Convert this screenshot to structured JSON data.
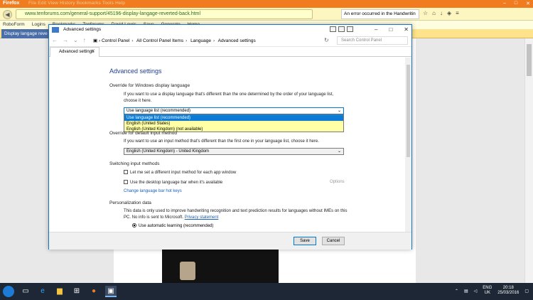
{
  "firefox": {
    "brand": "Firefox",
    "menus": "File  Edit  View  History  Bookmarks  Tools  Help",
    "url": "www.tenforums.com/general-support/45196-display-langage-reverted-back.html",
    "notice": "An error occurred in the Handwritin",
    "bookmarks": [
      "RoboForm",
      "Logins",
      "Bookmarks",
      "Tenforums",
      "David Lewis",
      "Save",
      "Generate",
      "Home"
    ],
    "tab_title": "Display langage reve"
  },
  "dialog": {
    "title": "Advanced settings",
    "breadcrumb": [
      "Control Panel",
      "All Control Panel Items",
      "Language",
      "Advanced settings"
    ],
    "search_placeholder": "Search Control Panel",
    "tab_label": "Advanced settings",
    "heading": "Advanced settings",
    "section1": "Override for Windows display language",
    "section1_text": "If you want to use a display language that's different than the one determined by the order of your language list, choose it here.",
    "combo1_value": "Use language list (recommended)",
    "dropdown_options": [
      "Use language list (recommended)",
      "English (United States)",
      "English (United Kingdom) (not available)"
    ],
    "section2": "Override for default input method",
    "section2_text": "If you want to use an input method that's different than the first one in your language list, choose it here.",
    "combo2_value": "English (United Kingdom) - United Kingdom",
    "section3": "Switching input methods",
    "check1": "Let me set a different input method for each app window",
    "check2": "Use the desktop language bar when it's available",
    "options_label": "Options",
    "hotkeys_link": "Change language bar hot keys",
    "section4": "Personalization data",
    "section4_text": "This data is only used to improve handwriting recognition and text prediction results for languages without IMEs on this PC. No info is sent to Microsoft.",
    "privacy_link": "Privacy statement",
    "radio1": "Use automatic learning (recommended)",
    "save": "Save",
    "cancel": "Cancel"
  },
  "taskbar": {
    "lang": "ENG",
    "region": "UK",
    "time": "20:18",
    "date": "25/03/2016"
  }
}
